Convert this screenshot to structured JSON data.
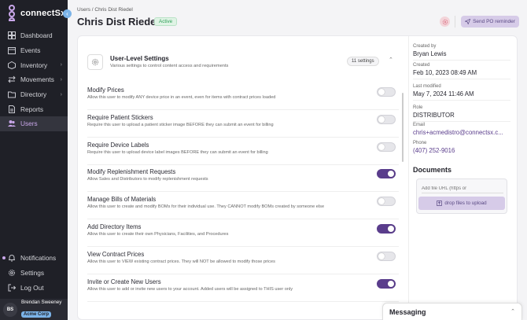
{
  "brand": {
    "name": "connectSx",
    "tagline": ""
  },
  "sidebar": {
    "items": [
      {
        "label": "Dashboard",
        "icon": "dashboard-icon"
      },
      {
        "label": "Events",
        "icon": "events-icon"
      },
      {
        "label": "Inventory",
        "icon": "inventory-icon"
      },
      {
        "label": "Movements",
        "icon": "movements-icon"
      },
      {
        "label": "Directory",
        "icon": "directory-icon"
      },
      {
        "label": "Reports",
        "icon": "reports-icon"
      },
      {
        "label": "Users",
        "icon": "users-icon"
      }
    ],
    "bottom": [
      {
        "label": "Notifications",
        "icon": "bell-icon"
      },
      {
        "label": "Settings",
        "icon": "gear-icon"
      },
      {
        "label": "Log Out",
        "icon": "logout-icon"
      }
    ],
    "user": {
      "initials": "BS",
      "name": "Brendan Sweeney",
      "org": "Acme Corp"
    }
  },
  "header": {
    "breadcrumb": "Users / Chris Dist Riedel",
    "title": "Chris Dist Riedel",
    "status": "Active",
    "send_label": "Send PO reminder"
  },
  "settings": {
    "title": "User-Level Settings",
    "description": "Various settings to control content access and requirements",
    "count": "11 settings",
    "rows": [
      {
        "title": "Modify Prices",
        "desc": "Allow this user to modify ANY device price in an event, even for items with contract prices loaded",
        "on": false
      },
      {
        "title": "Require Patient Stickers",
        "desc": "Require this user to upload a patient sticker image BEFORE they can submit an event for billing",
        "on": false
      },
      {
        "title": "Require Device Labels",
        "desc": "Require this user to upload device label images BEFORE they can submit an event for billing",
        "on": false
      },
      {
        "title": "Modify Replenishment Requests",
        "desc": "Allow Sales and Distributors to modify replenishment requests",
        "on": true
      },
      {
        "title": "Manage Bills of Materials",
        "desc": "Allow this user to create and modify BOMs for their individual use. They CANNOT modify BOMs created by someone else",
        "on": false
      },
      {
        "title": "Add Directory Items",
        "desc": "Allow this user to create their own Physicians, Facilities, and Procedures",
        "on": true
      },
      {
        "title": "View Contract Prices",
        "desc": "Allow this user to VIEW existing contract prices. They will NOT be allowed to modify those prices",
        "on": false
      },
      {
        "title": "Invite or Create New Users",
        "desc": "Allow this user to add or invite new users to your account. Added users will be assigned to THIS user only",
        "on": true
      }
    ]
  },
  "meta": {
    "created_by_label": "Created by",
    "created_by": "Bryan Lewis",
    "created_label": "Created",
    "created": "Feb 10, 2023 08:49 AM",
    "modified_label": "Last modified",
    "modified": "May 7, 2024 11:46 AM",
    "role_label": "Role",
    "role": "DISTRIBUTOR",
    "email_label": "Email",
    "email": "chris+acmedistro@connectsx.c...",
    "phone_label": "Phone",
    "phone": "(407) 252-9016"
  },
  "documents": {
    "title": "Documents",
    "url_placeholder": "Add file URL (https or",
    "drop_label": "drop files to upload"
  },
  "messaging": {
    "title": "Messaging"
  },
  "colors": {
    "accent": "#5a3d8c",
    "sidebar": "#1f2027",
    "active_green": "#2e9e57"
  }
}
